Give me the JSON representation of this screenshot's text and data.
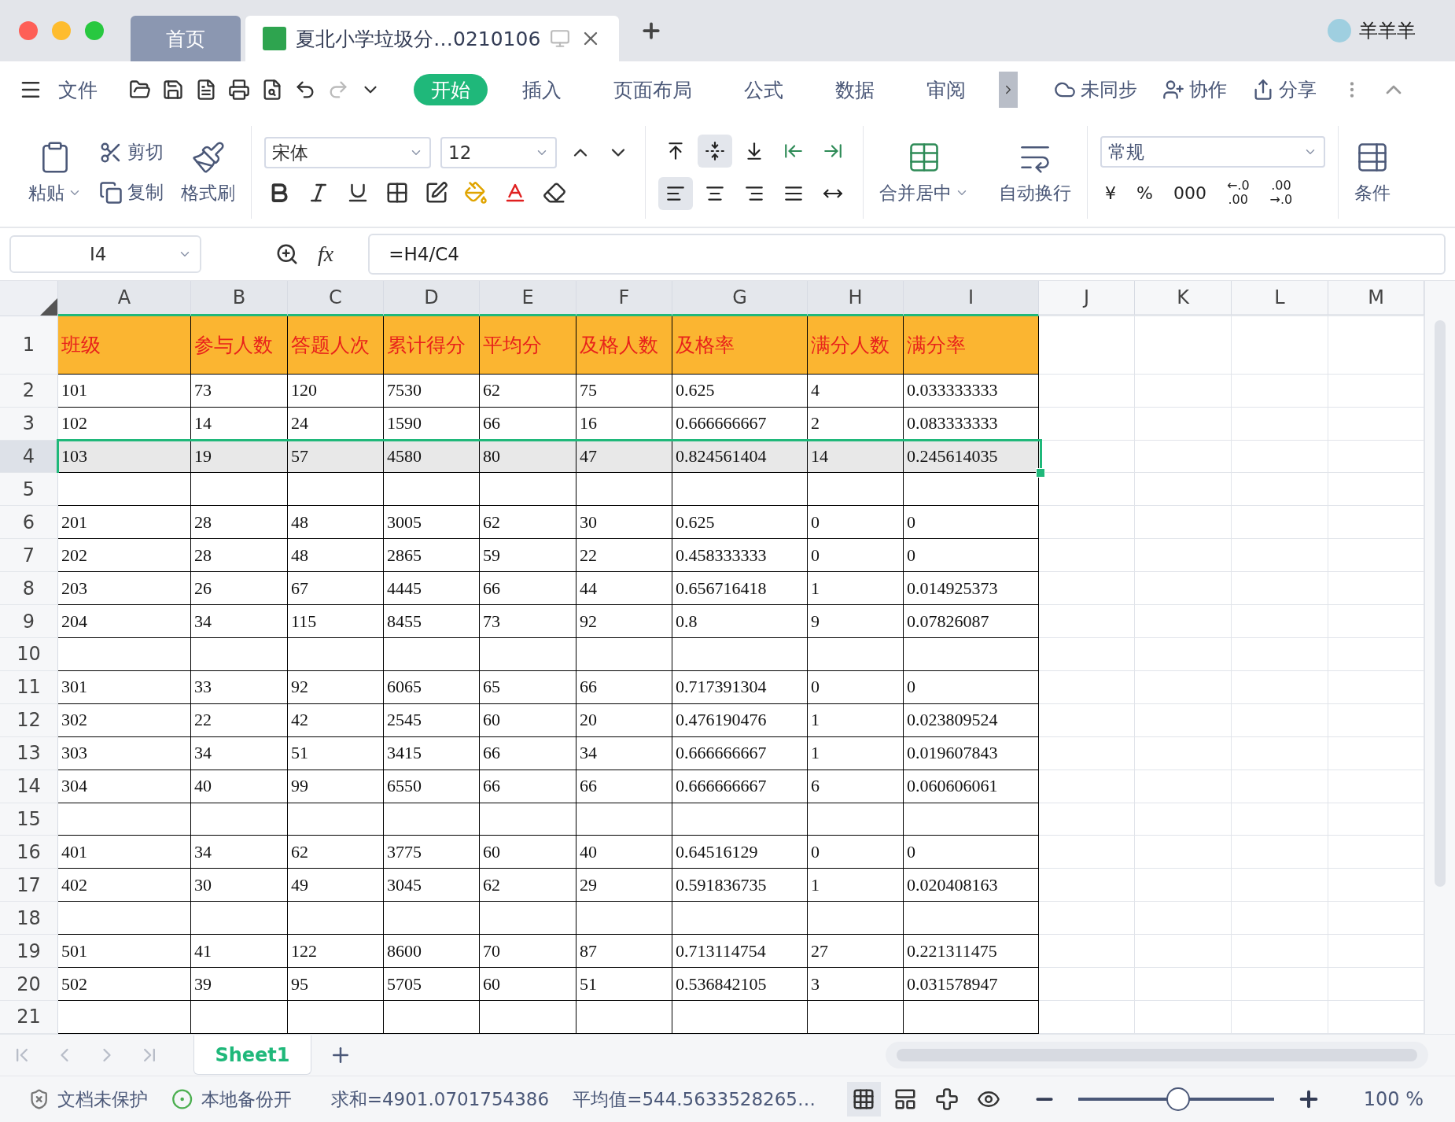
{
  "title_bar": {
    "tabs": [
      {
        "label": "首页",
        "kind": "home",
        "selected": false
      },
      {
        "label": "夏北小学垃圾分…0210106",
        "kind": "document",
        "selected": true
      }
    ],
    "user": "羊羊羊"
  },
  "menu_bar": {
    "file": "文件",
    "ribbon_tabs": [
      {
        "label": "开始",
        "selected": true
      },
      {
        "label": "插入",
        "selected": false
      },
      {
        "label": "页面布局",
        "selected": false
      },
      {
        "label": "公式",
        "selected": false
      },
      {
        "label": "数据",
        "selected": false
      },
      {
        "label": "审阅",
        "selected": false
      }
    ],
    "actions": [
      {
        "label": "未同步",
        "kind": "sync"
      },
      {
        "label": "协作",
        "kind": "collab"
      },
      {
        "label": "分享",
        "kind": "share"
      }
    ]
  },
  "ribbon": {
    "paste": "粘贴",
    "cut": "剪切",
    "copy": "复制",
    "format_painter": "格式刷",
    "font": "宋体",
    "font_size": "12",
    "vertical_align": [
      {
        "kind": "top",
        "selected": false
      },
      {
        "kind": "middle",
        "selected": true
      },
      {
        "kind": "bottom",
        "selected": false
      }
    ],
    "horizontal_align": [
      {
        "kind": "left",
        "selected": true
      },
      {
        "kind": "center",
        "selected": false
      },
      {
        "kind": "right",
        "selected": false
      },
      {
        "kind": "justify",
        "selected": false
      },
      {
        "kind": "distributed",
        "selected": false
      }
    ],
    "merge": "合并居中",
    "wrap": "自动换行",
    "number_format": "常规",
    "currency": "¥",
    "percent": "%",
    "thousands": "000",
    "increase_decimal": [
      "←.0",
      ".00"
    ],
    "decrease_decimal": [
      ".00",
      "→.0"
    ],
    "conditional": "条件"
  },
  "formula_bar": {
    "cell": "I4",
    "fx": "fx",
    "formula": "=H4/C4"
  },
  "sheet": {
    "columns": [
      {
        "label": "A",
        "selected": true
      },
      {
        "label": "B",
        "selected": true
      },
      {
        "label": "C",
        "selected": true
      },
      {
        "label": "D",
        "selected": true
      },
      {
        "label": "E",
        "selected": true
      },
      {
        "label": "F",
        "selected": true
      },
      {
        "label": "G",
        "selected": true
      },
      {
        "label": "H",
        "selected": true
      },
      {
        "label": "I",
        "selected": true
      },
      {
        "label": "J",
        "selected": false
      },
      {
        "label": "K",
        "selected": false
      },
      {
        "label": "L",
        "selected": false
      },
      {
        "label": "M",
        "selected": false
      }
    ],
    "rows": [
      {
        "number": "1",
        "kind": "header",
        "selected": false,
        "cells": [
          "班级",
          "参与人数",
          "答题人次",
          "累计得分",
          "平均分",
          "及格人数",
          "及格率",
          "满分人数",
          "满分率"
        ]
      },
      {
        "number": "2",
        "kind": "data",
        "selected": false,
        "cells": [
          "101",
          "73",
          "120",
          "7530",
          "62",
          "75",
          "0.625",
          "4",
          "0.033333333"
        ]
      },
      {
        "number": "3",
        "kind": "data",
        "selected": false,
        "cells": [
          "102",
          "14",
          "24",
          "1590",
          "66",
          "16",
          "0.666666667",
          "2",
          "0.083333333"
        ]
      },
      {
        "number": "4",
        "kind": "data",
        "selected": true,
        "cells": [
          "103",
          "19",
          "57",
          "4580",
          "80",
          "47",
          "0.824561404",
          "14",
          "0.245614035"
        ]
      },
      {
        "number": "5",
        "kind": "data",
        "selected": false
      },
      {
        "number": "6",
        "kind": "data",
        "selected": false,
        "cells": [
          "201",
          "28",
          "48",
          "3005",
          "62",
          "30",
          "0.625",
          "0",
          "0"
        ]
      },
      {
        "number": "7",
        "kind": "data",
        "selected": false,
        "cells": [
          "202",
          "28",
          "48",
          "2865",
          "59",
          "22",
          "0.458333333",
          "0",
          "0"
        ]
      },
      {
        "number": "8",
        "kind": "data",
        "selected": false,
        "cells": [
          "203",
          "26",
          "67",
          "4445",
          "66",
          "44",
          "0.656716418",
          "1",
          "0.014925373"
        ]
      },
      {
        "number": "9",
        "kind": "data",
        "selected": false,
        "cells": [
          "204",
          "34",
          "115",
          "8455",
          "73",
          "92",
          "0.8",
          "9",
          "0.07826087"
        ]
      },
      {
        "number": "10",
        "kind": "data",
        "selected": false
      },
      {
        "number": "11",
        "kind": "data",
        "selected": false,
        "cells": [
          "301",
          "33",
          "92",
          "6065",
          "65",
          "66",
          "0.717391304",
          "0",
          "0"
        ]
      },
      {
        "number": "12",
        "kind": "data",
        "selected": false,
        "cells": [
          "302",
          "22",
          "42",
          "2545",
          "60",
          "20",
          "0.476190476",
          "1",
          "0.023809524"
        ]
      },
      {
        "number": "13",
        "kind": "data",
        "selected": false,
        "cells": [
          "303",
          "34",
          "51",
          "3415",
          "66",
          "34",
          "0.666666667",
          "1",
          "0.019607843"
        ]
      },
      {
        "number": "14",
        "kind": "data",
        "selected": false,
        "cells": [
          "304",
          "40",
          "99",
          "6550",
          "66",
          "66",
          "0.666666667",
          "6",
          "0.060606061"
        ]
      },
      {
        "number": "15",
        "kind": "data",
        "selected": false
      },
      {
        "number": "16",
        "kind": "data",
        "selected": false,
        "cells": [
          "401",
          "34",
          "62",
          "3775",
          "60",
          "40",
          "0.64516129",
          "0",
          "0"
        ]
      },
      {
        "number": "17",
        "kind": "data",
        "selected": false,
        "cells": [
          "402",
          "30",
          "49",
          "3045",
          "62",
          "29",
          "0.591836735",
          "1",
          "0.020408163"
        ]
      },
      {
        "number": "18",
        "kind": "data",
        "selected": false
      },
      {
        "number": "19",
        "kind": "data",
        "selected": false,
        "cells": [
          "501",
          "41",
          "122",
          "8600",
          "70",
          "87",
          "0.713114754",
          "27",
          "0.221311475"
        ]
      },
      {
        "number": "20",
        "kind": "data",
        "selected": false,
        "cells": [
          "502",
          "39",
          "95",
          "5705",
          "60",
          "51",
          "0.536842105",
          "3",
          "0.031578947"
        ]
      },
      {
        "number": "21",
        "kind": "data",
        "selected": false
      }
    ]
  },
  "sheet_tabs": [
    {
      "label": "Sheet1",
      "selected": true
    }
  ],
  "status_bar": {
    "protection": "文档未保护",
    "backup": "本地备份开",
    "sum": "求和=4901.0701754386",
    "average": "平均值=544.5633528265…",
    "zoom": {
      "level": 0.51,
      "reading": "100 %"
    }
  }
}
